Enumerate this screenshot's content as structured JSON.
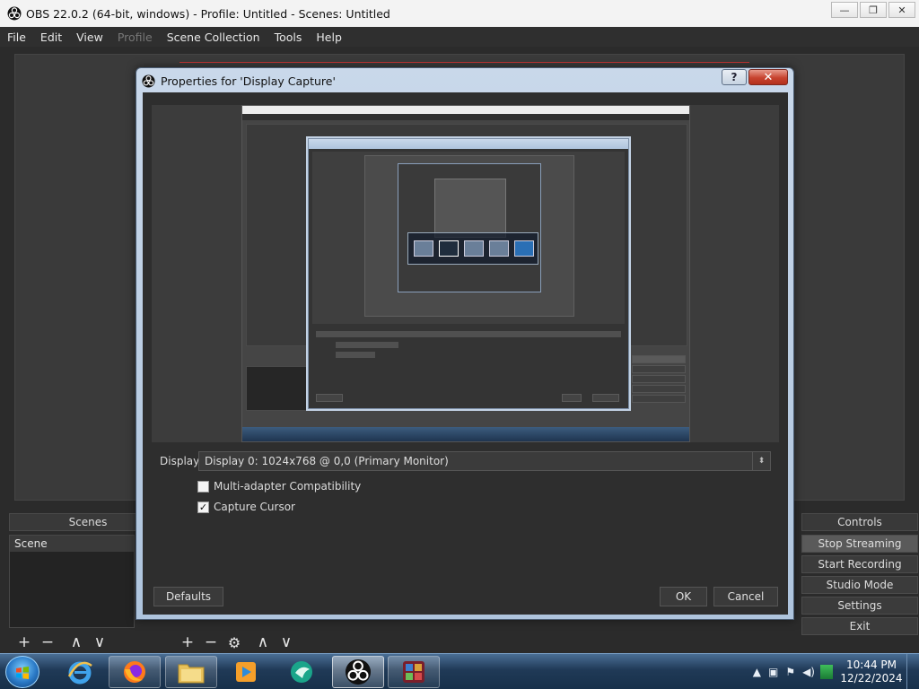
{
  "main_window": {
    "title": "OBS 22.0.2 (64-bit, windows) - Profile: Untitled - Scenes: Untitled",
    "controls": {
      "minimize": "—",
      "restore": "❐",
      "close": "✕"
    }
  },
  "menu": [
    "File",
    "Edit",
    "View",
    "Profile",
    "Scene Collection",
    "Tools",
    "Help"
  ],
  "docks": {
    "scenes_header": "Scenes",
    "controls_header": "Controls",
    "scenes": [
      "Scene"
    ]
  },
  "controls": [
    "Stop Streaming",
    "Start Recording",
    "Studio Mode",
    "Settings",
    "Exit"
  ],
  "toolbar_glyphs": {
    "add": "+",
    "remove": "−",
    "up": "∧",
    "down": "∨",
    "gear": "⚙"
  },
  "dialog": {
    "title": "Properties for 'Display Capture'",
    "help_glyph": "?",
    "close_glyph": "✕",
    "display_label": "Display",
    "display_value": "Display 0: 1024x768 @ 0,0 (Primary Monitor)",
    "multi_adapter_label": "Multi-adapter Compatibility",
    "multi_adapter_checked": false,
    "capture_cursor_label": "Capture Cursor",
    "capture_cursor_checked": true,
    "check_glyph": "✓",
    "defaults_label": "Defaults",
    "ok_label": "OK",
    "cancel_label": "Cancel"
  },
  "taskbar": {
    "time": "10:44 PM",
    "date": "12/22/2024",
    "items": [
      "start-orb",
      "internet-explorer-icon",
      "firefox-icon",
      "file-explorer-icon",
      "media-player-icon",
      "bird-app-icon",
      "obs-icon",
      "game-app-icon"
    ]
  },
  "colors": {
    "obs_dark": "#2b2b2b",
    "dialog_frame": "#aec4dd",
    "close_red": "#c7432f",
    "taskbar": "#203a57"
  }
}
